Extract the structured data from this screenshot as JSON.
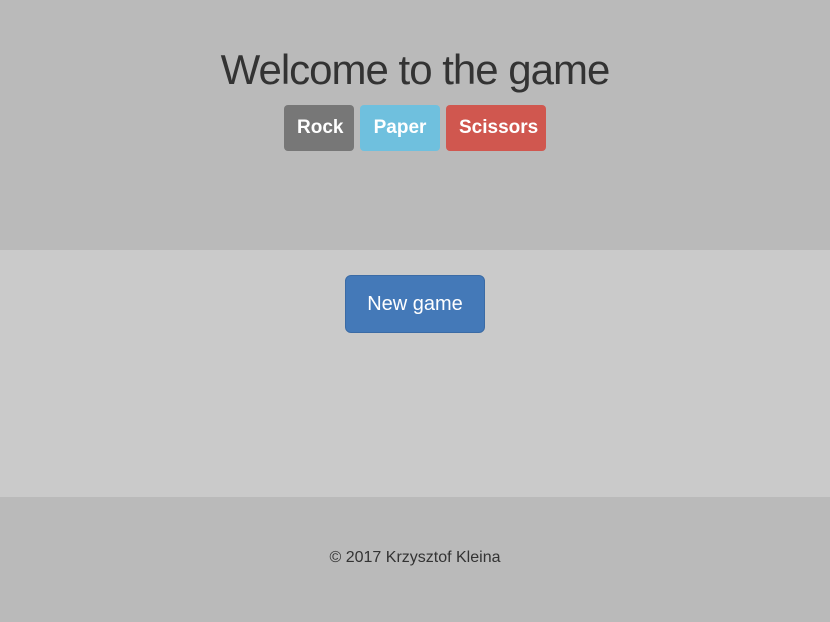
{
  "header": {
    "title": "Welcome to the game"
  },
  "choices": [
    {
      "label": "Rock",
      "color": "#777777"
    },
    {
      "label": "Paper",
      "color": "#6fc0de"
    },
    {
      "label": "Scissors",
      "color": "#d0574f"
    }
  ],
  "main": {
    "new_game_label": "New game",
    "accent": "#4479b8"
  },
  "footer": {
    "copyright": "© 2017 Krzysztof Kleina"
  }
}
